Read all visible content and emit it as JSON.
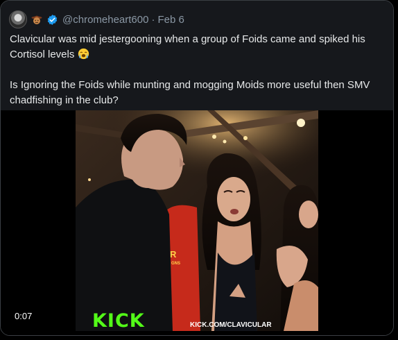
{
  "post": {
    "handle": "@chromeheart600",
    "separator": "·",
    "date": "Feb 6",
    "paragraph_1": "Clavicular was mid jestergooning when a group of Foids came and spiked his Cortisol levels",
    "paragraph_2": "Is Ignoring the Foids while munting and mogging Moids more useful then SMV chadfishing in the club?"
  },
  "video": {
    "timestamp": "0:07",
    "logo_text": "KICK",
    "watermark_text": "KICK.COM/CLAVICULAR",
    "shirt_text": "R",
    "shirt_text_small": "GNS"
  },
  "colors": {
    "header_bg": "#16181c",
    "text_primary": "#e7e9ea",
    "text_secondary": "#8b98a5",
    "verified_blue": "#1d9bf0",
    "kick_green": "#53fc18"
  },
  "icons": {
    "avatar": "avatar",
    "name_emoji": "cowboy-emoji-icon",
    "verified": "verified-badge-icon",
    "post_emoji": "loudly-crying-face-icon"
  }
}
